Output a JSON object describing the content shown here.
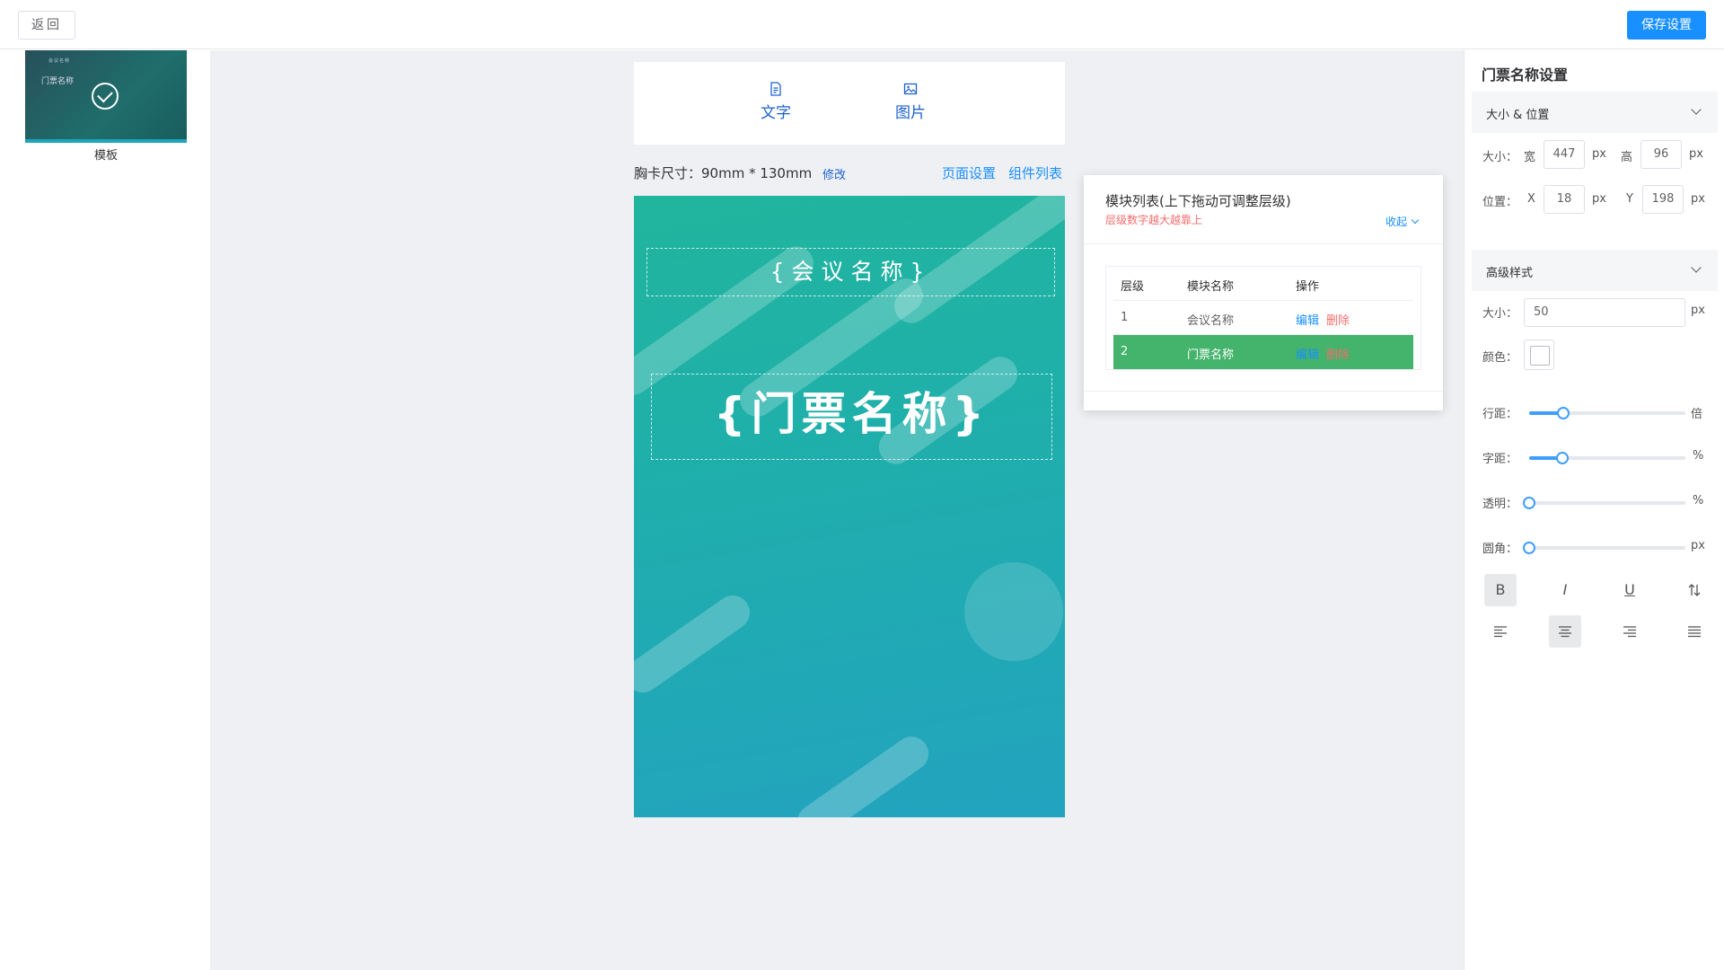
{
  "header": {
    "back_label": "返回",
    "save_label": "保存设置"
  },
  "template_panel": {
    "thumb_title": "门票名称",
    "thumb_subtitle": "会议名称",
    "label": "模板"
  },
  "toolbox": {
    "text_label": "文字",
    "image_label": "图片"
  },
  "card_info": {
    "size_text": "胸卡尺寸：90mm * 130mm",
    "modify_label": "修改",
    "page_settings_label": "页面设置",
    "component_list_label": "组件列表"
  },
  "card": {
    "conference_placeholder": "{会议名称}",
    "ticket_placeholder": "{门票名称}",
    "ticket_font_size_px": 50
  },
  "layer_panel": {
    "title": "模块列表(上下拖动可调整层级)",
    "subtitle": "层级数字越大越靠上",
    "collapse_label": "收起",
    "columns": [
      "层级",
      "模块名称",
      "操作"
    ],
    "rows": [
      {
        "level": "1",
        "name": "会议名称",
        "edit": "编辑",
        "delete": "删除",
        "selected": false
      },
      {
        "level": "2",
        "name": "门票名称",
        "edit": "编辑",
        "delete": "删除",
        "selected": true
      }
    ],
    "selected_color": "#44b36b"
  },
  "settings": {
    "title": "门票名称设置",
    "section_size_pos": "大小 & 位置",
    "size_label": "大小：",
    "width_label": "宽",
    "width_value": "447",
    "height_label": "高",
    "height_value": "96",
    "position_label": "位置：",
    "x_label": "X",
    "x_value": "18",
    "y_label": "Y",
    "y_value": "198",
    "px_unit": "px",
    "section_advanced": "高级样式",
    "font_size_label": "大小：",
    "font_size_value": "50",
    "color_label": "颜色：",
    "color_value": "#ffffff",
    "line_height_label": "行距：",
    "line_height_unit": "倍",
    "line_height_fraction": 0.22,
    "letter_spacing_label": "字距：",
    "letter_spacing_unit": "%",
    "letter_spacing_fraction": 0.21,
    "opacity_label": "透明：",
    "opacity_unit": "%",
    "opacity_fraction": 0.0,
    "radius_label": "圆角：",
    "radius_unit": "px",
    "radius_fraction": 0.0,
    "bold_glyph": "B",
    "italic_glyph": "I",
    "underline_glyph": "U",
    "accent_color": "#409eff"
  }
}
